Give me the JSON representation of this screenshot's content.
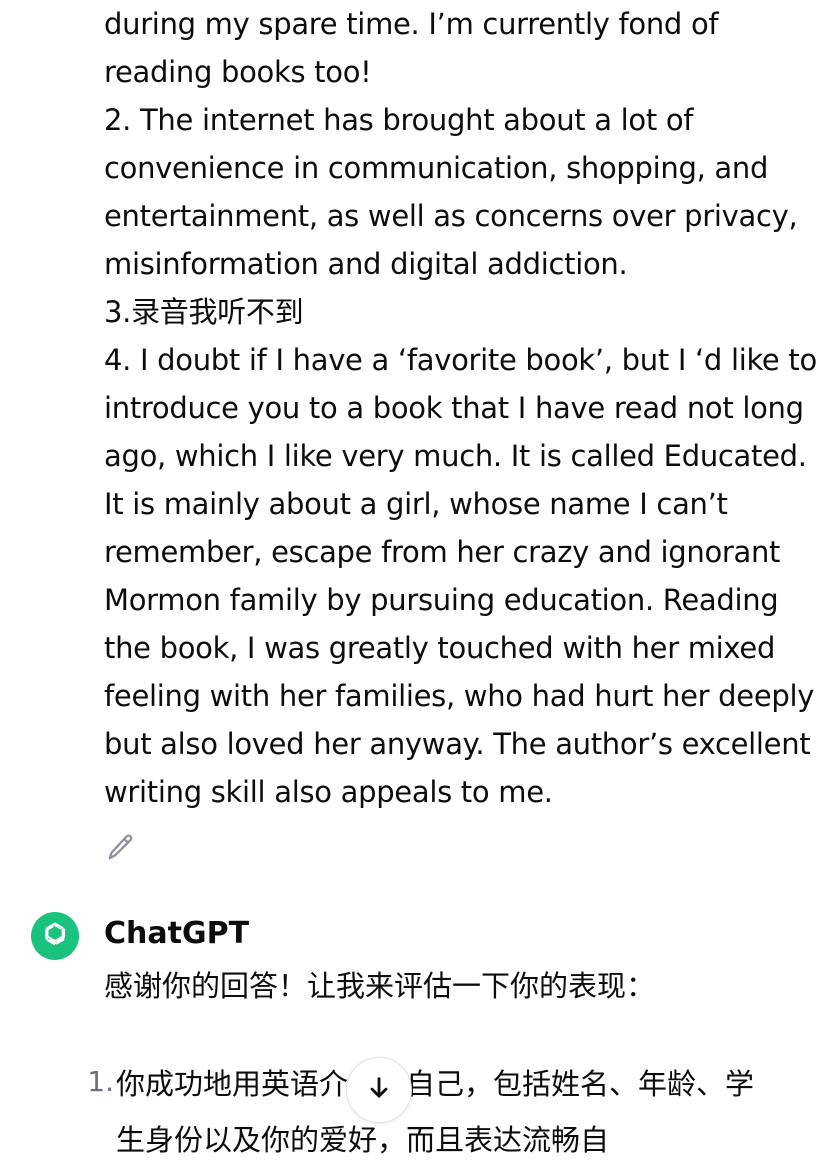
{
  "user_message": {
    "lines": [
      "during my spare time. I’m currently fond of",
      "reading books too!",
      "2. The internet has brought about a lot of",
      "convenience in communication, shopping, and",
      "entertainment, as well as concerns over privacy,",
      "misinformation and digital addiction.",
      "3.录音我听不到",
      "4. I doubt if I have a ‘favorite book’, but I ‘d like to",
      "introduce you to a book that I have read not long",
      "ago, which I like very much. It is called Educated.",
      "It is mainly about a girl, whose name I can’t",
      "remember, escape from her crazy and ignorant",
      "Mormon family by pursuing education. Reading",
      "the book, I was greatly touched with her mixed",
      "feeling with her families, who had hurt her deeply",
      "but also loved her anyway. The author’s excellent",
      "writing skill also appeals to me."
    ],
    "edit_icon": "pencil-icon"
  },
  "assistant": {
    "name": "ChatGPT",
    "avatar_icon": "openai-logo-icon",
    "avatar_color": "#19c37d",
    "intro": "感谢你的回答！让我来评估一下你的表现：",
    "list": [
      {
        "num": "1.",
        "text": "你成功地用英语介绍了自己，包括姓名、年龄、学生身份以及你的爱好，而且表达流畅自"
      }
    ]
  },
  "scroll_button": {
    "icon": "arrow-down-icon"
  }
}
